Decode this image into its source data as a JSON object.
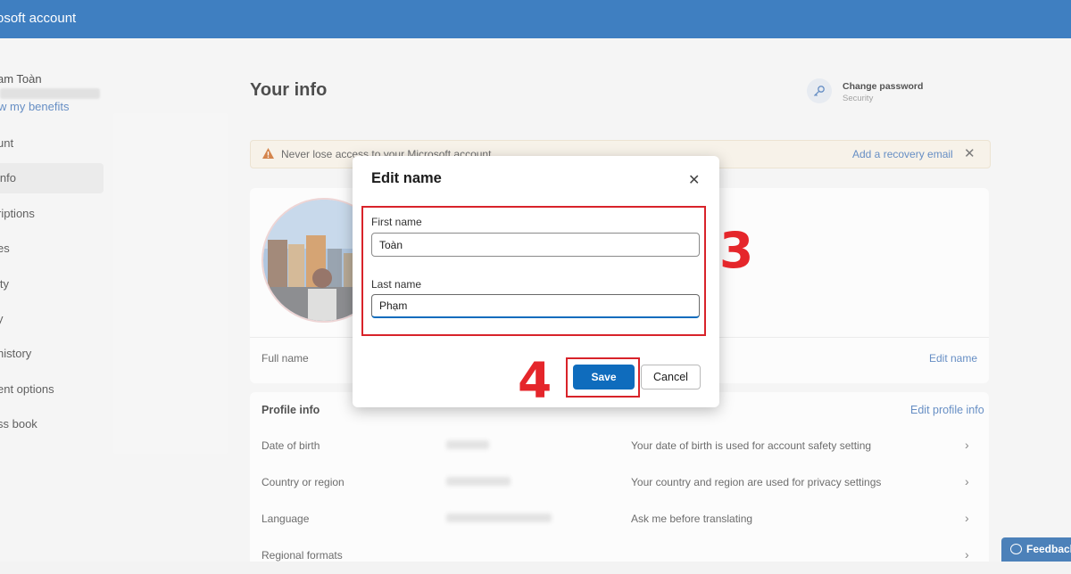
{
  "topbar": {
    "title": "osoft account"
  },
  "sidebar": {
    "user_name": "am Toàn",
    "benefits_link": "w my benefits",
    "items": [
      {
        "label": "unt"
      },
      {
        "label": "info"
      },
      {
        "label": "riptions"
      },
      {
        "label": "es"
      },
      {
        "label": "ity"
      },
      {
        "label": "y"
      },
      {
        "label": " history"
      },
      {
        "label": "ent options"
      },
      {
        "label": "ss book"
      }
    ]
  },
  "main": {
    "page_title": "Your info",
    "change_password": {
      "title": "Change password",
      "subtitle": "Security"
    },
    "banner": {
      "message": "Never lose access to your Microsoft account",
      "action": "Add a recovery email"
    },
    "full_name_label": "Full name",
    "edit_name_link": "Edit name",
    "profile_info": {
      "title": "Profile info",
      "edit_link": "Edit profile info",
      "rows": [
        {
          "label": "Date of birth",
          "description": "Your date of birth is used for account safety setting"
        },
        {
          "label": "Country or region",
          "description": "Your country and region are used for privacy settings"
        },
        {
          "label": "Language",
          "description": "Ask me before translating"
        },
        {
          "label": "Regional formats",
          "description": ""
        }
      ]
    },
    "feedback_label": "Feedback"
  },
  "dialog": {
    "title": "Edit name",
    "first_name_label": "First name",
    "first_name_value": "Toàn",
    "last_name_label": "Last name",
    "last_name_value": "Phạm",
    "save_label": "Save",
    "cancel_label": "Cancel"
  },
  "annotations": {
    "step_a": "3",
    "step_b": "4"
  },
  "colors": {
    "brand": "#0a5bb0",
    "accent": "#0f6cbd",
    "annotation": "#e5262b"
  }
}
